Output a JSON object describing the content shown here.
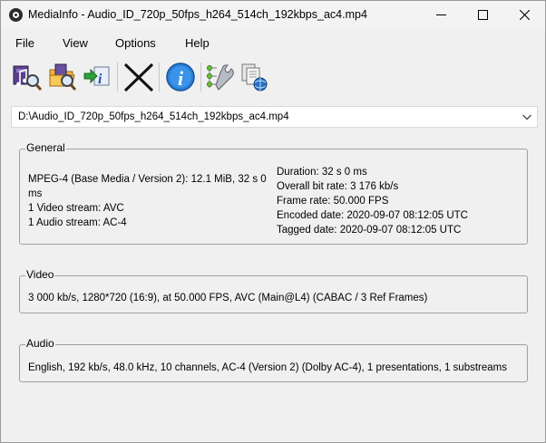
{
  "window": {
    "title": "MediaInfo - Audio_ID_720p_50fps_h264_514ch_192kbps_ac4.mp4",
    "icons": {
      "app": "mediainfo-app-icon",
      "minimize": "minimize-icon",
      "maximize": "maximize-icon",
      "close": "close-icon"
    }
  },
  "menu": {
    "file": "File",
    "view": "View",
    "options": "Options",
    "help": "Help"
  },
  "toolbar": {
    "buttons": [
      {
        "icon": "open-file-icon"
      },
      {
        "icon": "open-folder-icon"
      },
      {
        "icon": "export-icon"
      },
      {
        "icon": "close-file-icon"
      },
      {
        "icon": "info-icon"
      },
      {
        "icon": "preferences-icon"
      },
      {
        "icon": "web-update-icon"
      }
    ]
  },
  "file_select": {
    "value": "D:\\Audio_ID_720p_50fps_h264_514ch_192kbps_ac4.mp4"
  },
  "general": {
    "label": "General",
    "left": [
      "MPEG-4 (Base Media / Version 2): 12.1 MiB, 32 s 0",
      "ms",
      "1 Video stream: AVC",
      "1 Audio stream: AC-4"
    ],
    "right": [
      "Duration: 32 s 0 ms",
      "Overall bit rate: 3 176 kb/s",
      "Frame rate: 50.000 FPS",
      "Encoded date: 2020-09-07 08:12:05 UTC",
      "Tagged date: 2020-09-07 08:12:05 UTC"
    ]
  },
  "video": {
    "label": "Video",
    "text": "3 000 kb/s, 1280*720 (16:9), at 50.000 FPS, AVC (Main@L4) (CABAC / 3 Ref Frames)"
  },
  "audio": {
    "label": "Audio",
    "text": "English, 192 kb/s, 48.0 kHz, 10 channels, AC-4 (Version 2) (Dolby AC-4), 1 presentations, 1 substreams"
  }
}
